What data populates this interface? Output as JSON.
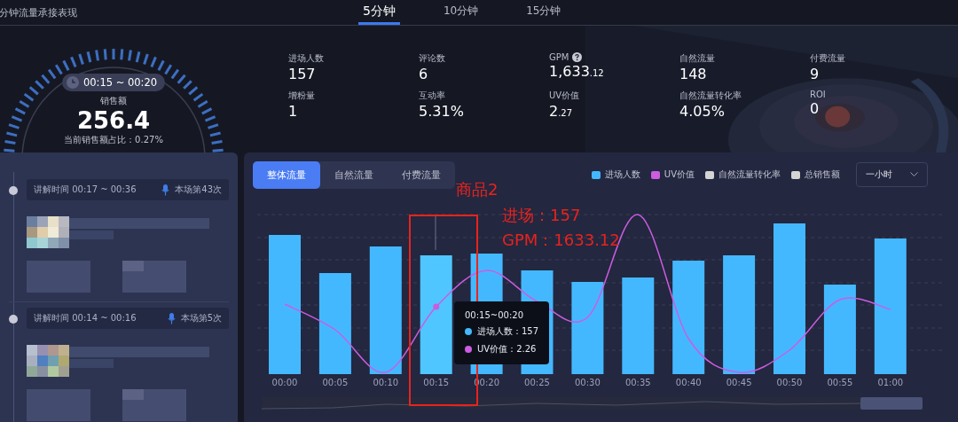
{
  "header": {
    "title": "分钟流量承接表现",
    "tabs": [
      {
        "label": "5分钟",
        "selected": true
      },
      {
        "label": "10分钟",
        "selected": false
      },
      {
        "label": "15分钟",
        "selected": false
      }
    ]
  },
  "gauge": {
    "time_range": "00:15 ~ 00:20",
    "label": "销售额",
    "value": "256.4",
    "share": "当前销售额占比：0.27%"
  },
  "metrics": [
    {
      "label": "进场人数",
      "value": "157"
    },
    {
      "label": "评论数",
      "value": "6"
    },
    {
      "label": "GPM",
      "value": "1,633",
      "fraction": ".12",
      "help": true
    },
    {
      "label": "自然流量",
      "value": "148"
    },
    {
      "label": "付费流量",
      "value": "9"
    },
    {
      "label": "增粉量",
      "value": "1"
    },
    {
      "label": "互动率",
      "value": "5.31%"
    },
    {
      "label": "UV价值",
      "value": "2",
      "fraction": ".27"
    },
    {
      "label": "自然流量转化率",
      "value": "4.05%"
    },
    {
      "label": "ROI",
      "value": "0"
    }
  ],
  "timeline": [
    {
      "time": "讲解时间 00:17 ~ 00:36",
      "count": "本场第43次"
    },
    {
      "time": "讲解时间 00:14 ~ 00:16",
      "count": "本场第5次"
    }
  ],
  "chart": {
    "tabs": [
      {
        "label": "整体流量",
        "selected": true
      },
      {
        "label": "自然流量",
        "selected": false
      },
      {
        "label": "付费流量",
        "selected": false
      }
    ],
    "legend": [
      {
        "label": "进场人数",
        "color": "#44b8ff"
      },
      {
        "label": "UV价值",
        "color": "#cc5ce0"
      },
      {
        "label": "自然流量转化率",
        "color": "#d4d4d4"
      },
      {
        "label": "总销售额",
        "color": "#d4d4d4"
      }
    ],
    "range": "一小时",
    "x_labels": [
      "00:00",
      "00:05",
      "00:10",
      "00:15",
      "00:20",
      "00:25",
      "00:30",
      "00:35",
      "00:40",
      "00:45",
      "00:50",
      "00:55",
      "01:00"
    ],
    "tooltip": {
      "title": "00:15~00:20",
      "rows": [
        {
          "label": "进场人数：157",
          "color": "#44b8ff"
        },
        {
          "label": "UV价值：2.26",
          "color": "#cc5ce0"
        }
      ]
    }
  },
  "annotation": {
    "title": "商品2",
    "lines": [
      "进场：157",
      "GPM：1633.12"
    ]
  }
}
